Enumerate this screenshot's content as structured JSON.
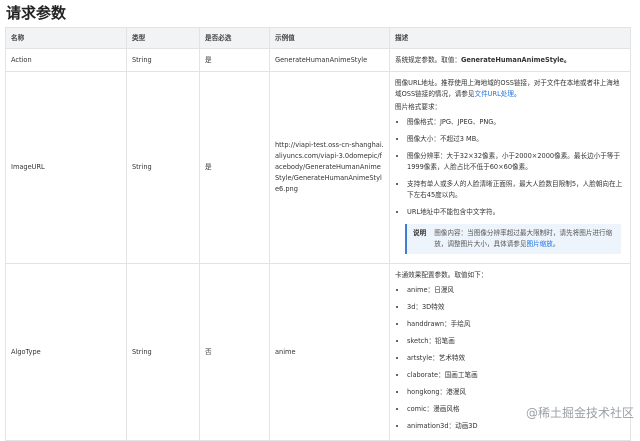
{
  "title": "请求参数",
  "headers": [
    "名称",
    "类型",
    "是否必选",
    "示例值",
    "描述"
  ],
  "rows": {
    "action": {
      "name": "Action",
      "type": "String",
      "required": "是",
      "example": "GenerateHumanAnimeStyle",
      "desc_prefix": "系统规定参数。取值：",
      "desc_bold": "GenerateHumanAnimeStyle。"
    },
    "image": {
      "name": "ImageURL",
      "type": "String",
      "required": "是",
      "example": "http://viapi-test.oss-cn-shanghai.aliyuncs.com/viapi-3.0domepic/facebody/GenerateHumanAnimeStyle/GenerateHumanAnimeStyle6.png",
      "desc_line1": "图像URL地址。推荐使用上海地域的OSS链接，对于文件在本地或者非上海地域OSS链接的情况，请参见",
      "desc_link": "文件URL处理",
      "desc_line1_end": "。",
      "desc_line2": "图片格式要求：",
      "bullets": [
        "图像格式：JPG、JPEG、PNG。",
        "图像大小：不超过3 MB。",
        "图像分辨率：大于32×32像素，小于2000×2000像素。最长边小于等于1999像素，人脸占比不低于60×60像素。",
        "支持有单人或多人的人脸清晰正面照，最大人脸数目限制5，人脸朝向在上下左右45度以内。",
        "URL地址中不能包含中文字符。"
      ],
      "note_label": "说明",
      "note_text": "图像内容：当图像分辨率超过最大限制时，请先将图片进行缩放，调整图片大小，具体请参见",
      "note_link": "图片缩放",
      "note_end": "。"
    },
    "algo": {
      "name": "AlgoType",
      "type": "String",
      "required": "否",
      "example": "anime",
      "desc_line": "卡通效果配置参数。取值如下：",
      "bullets": [
        "anime：日漫风",
        "3d：3D特效",
        "handdrawn：手绘风",
        "sketch：铅笔画",
        "artstyle：艺术特效",
        "claborate：国画工笔画",
        "hongkong：港漫风",
        "comic：漫画风格",
        "animation3d：动画3D"
      ]
    }
  },
  "watermark": "@稀土掘金技术社区"
}
